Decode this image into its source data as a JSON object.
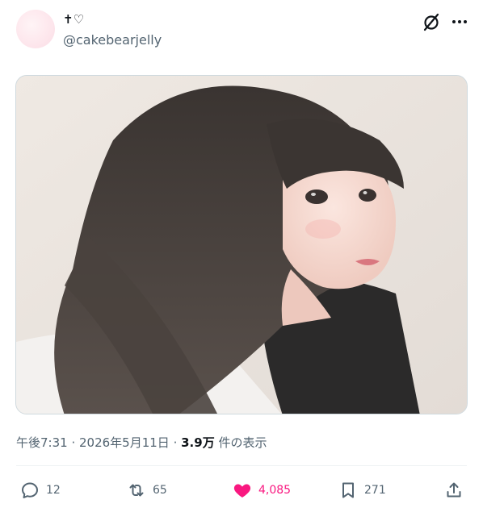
{
  "author": {
    "display_name": "✝♡",
    "handle": "@cakebearjelly"
  },
  "header_icons": [
    "grok-icon",
    "more-icon"
  ],
  "post": {
    "time": "午後7:31",
    "separator_1": " · ",
    "date": "2026年5月11日",
    "separator_2": " · ",
    "views": "3.9万",
    "views_suffix": " 件の表示"
  },
  "actions": {
    "replies": "12",
    "reposts": "65",
    "likes": "4,085",
    "bookmarks": "271"
  },
  "colors": {
    "text": "#0f1419",
    "secondary": "#536471",
    "like_active": "#f91880",
    "divider": "#eff3f4"
  }
}
